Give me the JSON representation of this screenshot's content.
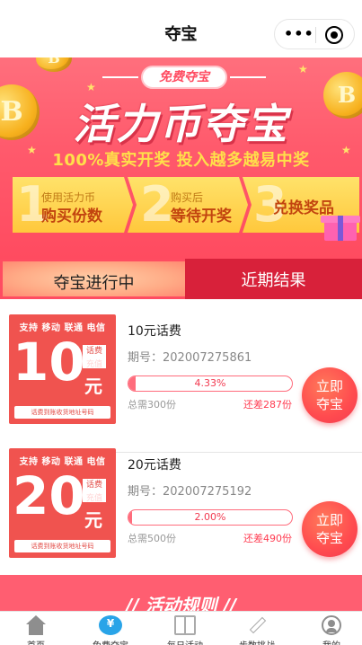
{
  "nav": {
    "title": "夺宝",
    "more_icon": "ellipsis-icon",
    "close_icon": "target-close-icon"
  },
  "banner": {
    "pill": "免费夺宝",
    "title": "活力币夺宝",
    "subtitle": "100%真实开奖 投入越多越易中奖",
    "coin_letter": "B",
    "steps": [
      {
        "num": "1",
        "line1": "使用活力币",
        "line2": "购买份数"
      },
      {
        "num": "2",
        "line1": "购买后",
        "line2": "等待开奖"
      },
      {
        "num": "3",
        "line1": "",
        "line2": "兑换奖品"
      }
    ]
  },
  "tabs": {
    "active": "夺宝进行中",
    "other": "近期结果"
  },
  "items": [
    {
      "card": {
        "top": "支持 移动 联通 电信",
        "amount": "10",
        "tag1": "话费",
        "tag2": "充值",
        "unit": "元",
        "bottom": "话费到账收货地址号码"
      },
      "name": "10元话费",
      "issue": "期号：202007275861",
      "percent": 0.0433,
      "percent_label": "4.33%",
      "need": "总需300份",
      "short": "还差287份",
      "button": [
        "立即",
        "夺宝"
      ]
    },
    {
      "card": {
        "top": "支持 移动 联通 电信",
        "amount": "20",
        "tag1": "话费",
        "tag2": "充值",
        "unit": "元",
        "bottom": "话费到账收货地址号码"
      },
      "name": "20元话费",
      "issue": "期号：202007275192",
      "percent": 0.02,
      "percent_label": "2.00%",
      "need": "总需500份",
      "short": "还差490份",
      "button": [
        "立即",
        "夺宝"
      ]
    }
  ],
  "rules": {
    "title": "// 活动规则 //"
  },
  "tabbar": [
    {
      "label": "首页",
      "icon": "home-icon"
    },
    {
      "label": "免费夺宝",
      "icon": "piggy-bank-icon"
    },
    {
      "label": "每日活动",
      "icon": "gift-icon"
    },
    {
      "label": "步数挑战",
      "icon": "pen-icon"
    },
    {
      "label": "我的",
      "icon": "user-icon"
    }
  ],
  "colors": {
    "brand": "#ff5a6c",
    "dark_red": "#d8213a",
    "yellow": "#ffe04a"
  }
}
